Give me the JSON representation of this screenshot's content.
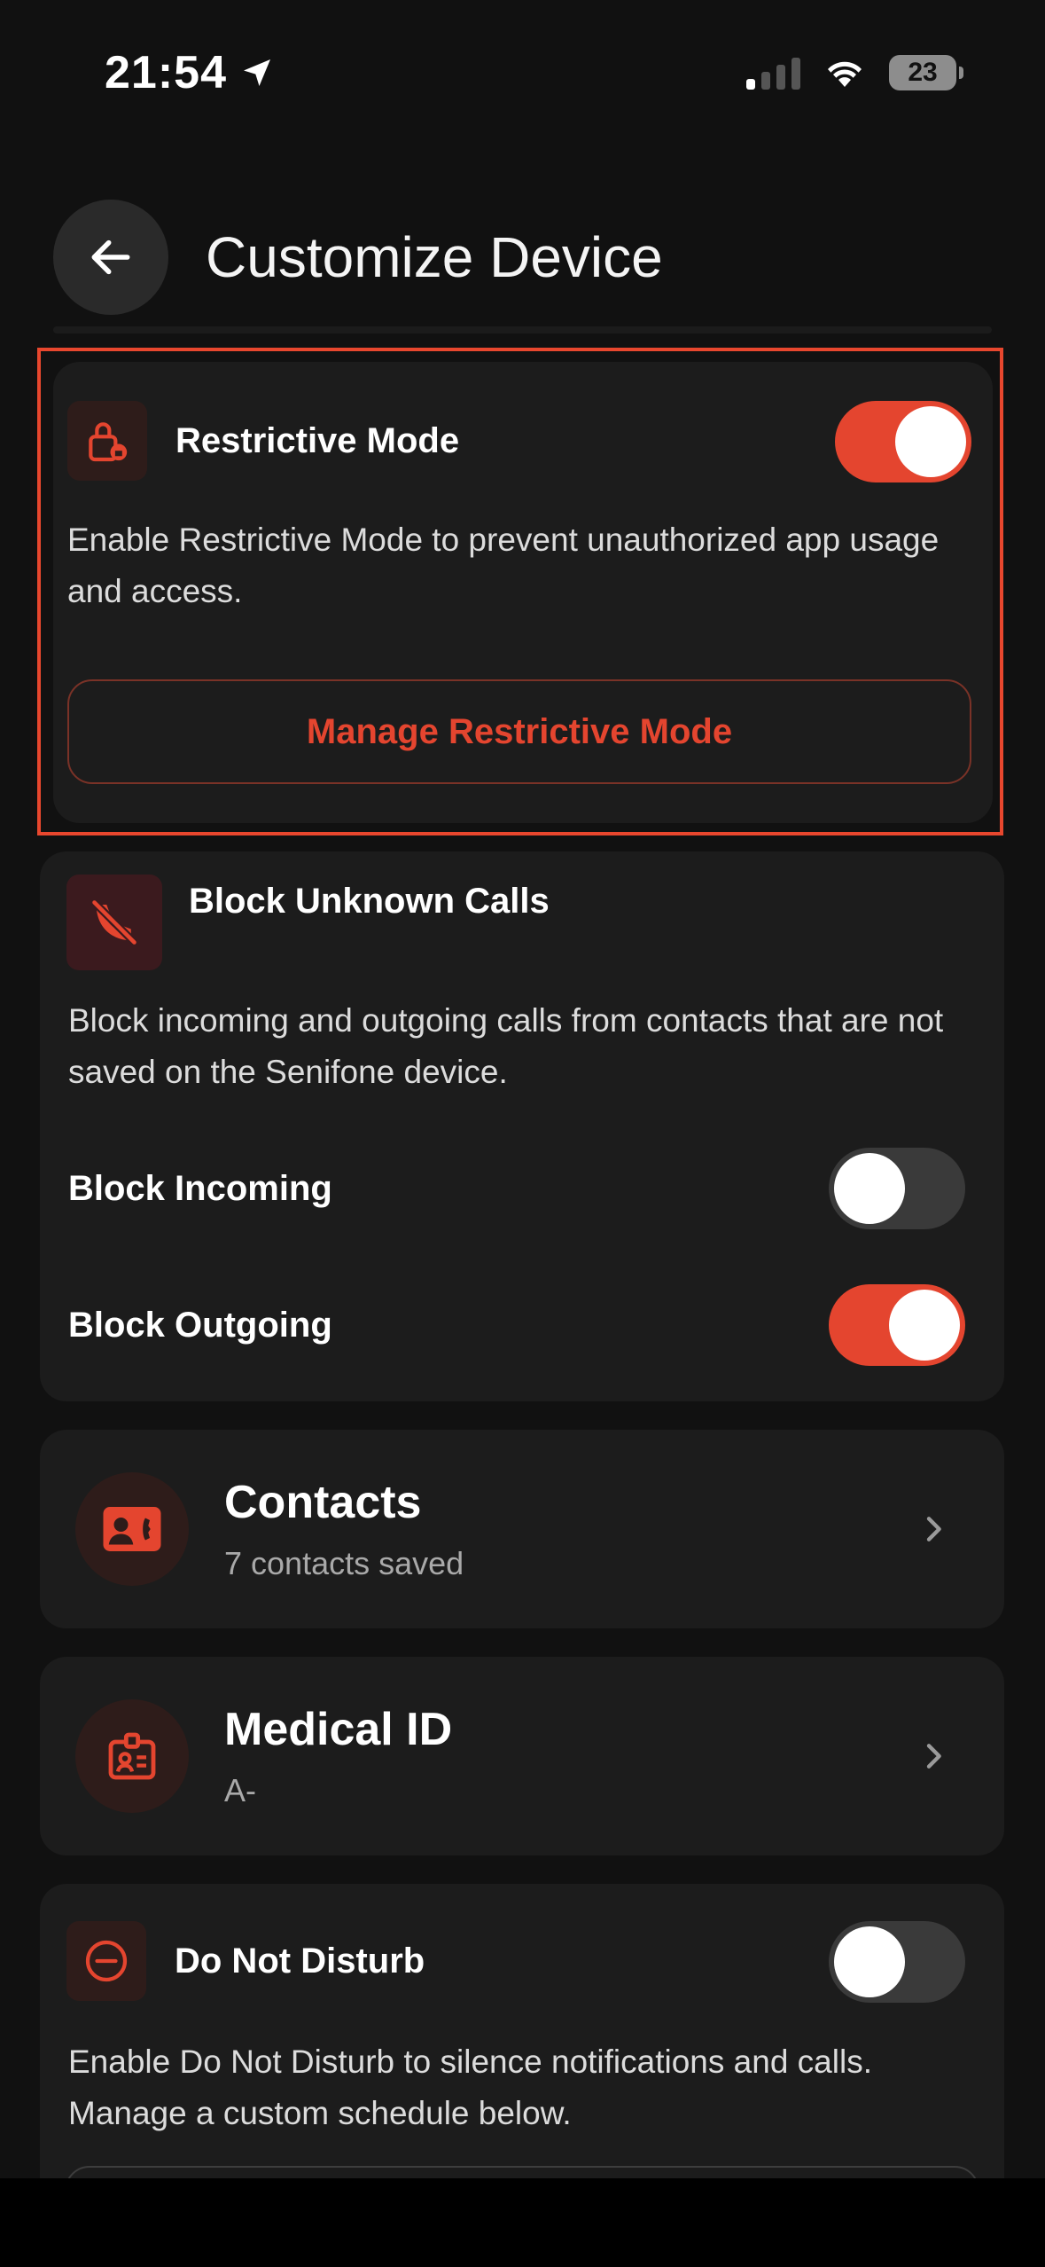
{
  "status_bar": {
    "time": "21:54",
    "battery": "23"
  },
  "header": {
    "title": "Customize Device"
  },
  "restrictive_mode": {
    "title": "Restrictive Mode",
    "enabled": true,
    "description": "Enable Restrictive Mode to prevent unauthorized app usage and access.",
    "button_label": "Manage Restrictive Mode"
  },
  "block_unknown_calls": {
    "title": "Block Unknown Calls",
    "description": "Block incoming and outgoing calls from contacts that are not saved on the Senifone device.",
    "block_incoming": {
      "label": "Block Incoming",
      "enabled": false
    },
    "block_outgoing": {
      "label": "Block Outgoing",
      "enabled": true
    }
  },
  "contacts": {
    "title": "Contacts",
    "subtitle": "7 contacts saved"
  },
  "medical_id": {
    "title": "Medical ID",
    "subtitle": "A-"
  },
  "do_not_disturb": {
    "title": "Do Not Disturb",
    "enabled": false,
    "description": "Enable Do Not Disturb to silence notifications and calls. Manage a custom schedule below."
  },
  "colors": {
    "accent": "#e4452f",
    "background": "#111111",
    "card": "#1c1c1c"
  }
}
